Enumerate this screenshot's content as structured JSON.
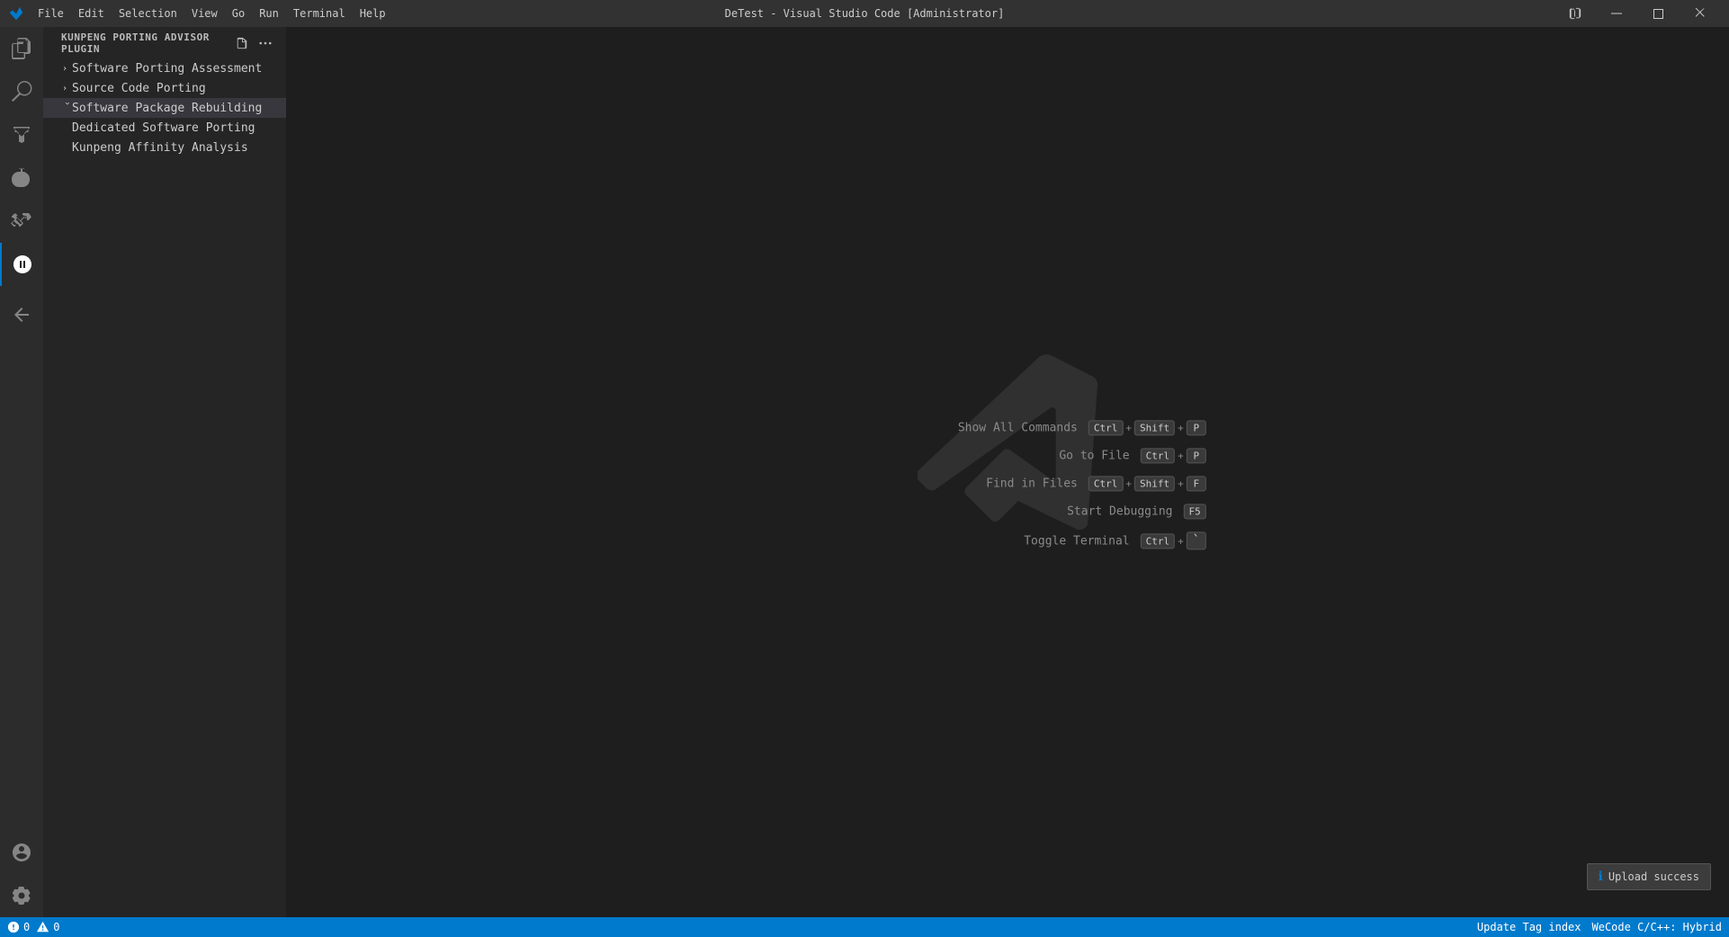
{
  "titleBar": {
    "title": "DeTest - Visual Studio Code [Administrator]",
    "menuItems": [
      "File",
      "Edit",
      "Selection",
      "View",
      "Go",
      "Run",
      "Terminal",
      "Help"
    ],
    "controls": {
      "split": "⊞",
      "minimize": "─",
      "maximize": "□",
      "close": "✕"
    }
  },
  "sidebar": {
    "header": "KUNPENG PORTING ADVISOR PLUGIN",
    "items": [
      {
        "label": "Software Porting Assessment",
        "expanded": false,
        "level": 0
      },
      {
        "label": "Source Code Porting",
        "expanded": false,
        "level": 0
      },
      {
        "label": "Software Package Rebuilding",
        "expanded": true,
        "level": 0
      },
      {
        "label": "Dedicated Software Porting",
        "expanded": false,
        "level": 1,
        "isChild": true
      },
      {
        "label": "Kunpeng Affinity Analysis",
        "expanded": false,
        "level": 1,
        "isChild": true
      }
    ]
  },
  "shortcuts": [
    {
      "label": "Show All Commands",
      "keys": [
        "Ctrl",
        "+",
        "Shift",
        "+",
        "P"
      ]
    },
    {
      "label": "Go to File",
      "keys": [
        "Ctrl",
        "+",
        "P"
      ]
    },
    {
      "label": "Find in Files",
      "keys": [
        "Ctrl",
        "+",
        "Shift",
        "+",
        "F"
      ]
    },
    {
      "label": "Start Debugging",
      "keys": [
        "F5"
      ]
    },
    {
      "label": "Toggle Terminal",
      "keys": [
        "Ctrl",
        "+",
        "`"
      ]
    }
  ],
  "statusBar": {
    "left": [
      {
        "icon": "✕",
        "text": "0"
      },
      {
        "icon": "⚠",
        "text": "0"
      }
    ],
    "right": [
      {
        "text": "Update Tag index"
      },
      {
        "text": "WeCode C/C++: Hybrid"
      },
      {
        "text": "⓪ Upload success"
      }
    ]
  },
  "notification": {
    "icon": "ℹ",
    "text": "Upload success"
  }
}
